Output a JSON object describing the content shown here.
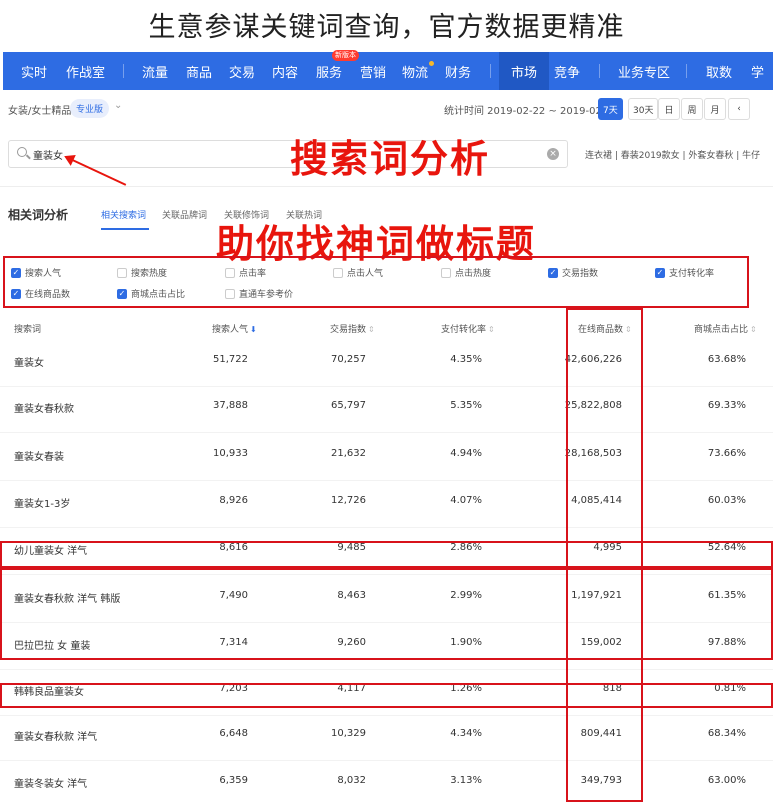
{
  "headline": "生意参谋关键词查询，官方数据更精准",
  "nav": {
    "items": [
      "实时",
      "作战室",
      "流量",
      "商品",
      "交易",
      "内容",
      "服务",
      "营销",
      "物流",
      "财务",
      "市场",
      "竞争",
      "业务专区",
      "取数",
      "学"
    ],
    "badge": "新版本",
    "active": "市场"
  },
  "filter": {
    "category": "女装/女士精品",
    "pro_badge": "专业版",
    "stat_time": "统计时间 2019-02-22 ~ 2019-02-28",
    "periods": [
      "7天",
      "30天",
      "日",
      "周",
      "月",
      "‹"
    ]
  },
  "search": {
    "value": "童装女",
    "hotwords": "连衣裙 | 春装2019款女 | 外套女春秋 | 牛仔"
  },
  "overlay": {
    "title1": "搜索词分析",
    "title2": "助你找神词做标题"
  },
  "section": {
    "title": "相关词分析",
    "tabs": [
      "相关搜索词",
      "关联品牌词",
      "关联修饰词",
      "关联热词"
    ]
  },
  "metrics": [
    {
      "label": "搜索人气",
      "checked": true
    },
    {
      "label": "搜索热度",
      "checked": false
    },
    {
      "label": "点击率",
      "checked": false
    },
    {
      "label": "点击人气",
      "checked": false
    },
    {
      "label": "点击热度",
      "checked": false
    },
    {
      "label": "交易指数",
      "checked": true
    },
    {
      "label": "支付转化率",
      "checked": true
    },
    {
      "label": "在线商品数",
      "checked": true
    },
    {
      "label": "商城点击占比",
      "checked": true
    },
    {
      "label": "直通车参考价",
      "checked": false
    }
  ],
  "table": {
    "headers": [
      "搜索词",
      "搜索人气",
      "交易指数",
      "支付转化率",
      "在线商品数",
      "商城点击占比"
    ],
    "rows": [
      [
        "童装女",
        "51,722",
        "70,257",
        "4.35%",
        "42,606,226",
        "63.68%"
      ],
      [
        "童装女春秋款",
        "37,888",
        "65,797",
        "5.35%",
        "25,822,808",
        "69.33%"
      ],
      [
        "童装女春装",
        "10,933",
        "21,632",
        "4.94%",
        "28,168,503",
        "73.66%"
      ],
      [
        "童装女1-3岁",
        "8,926",
        "12,726",
        "4.07%",
        "4,085,414",
        "60.03%"
      ],
      [
        "幼儿童装女 洋气",
        "8,616",
        "9,485",
        "2.86%",
        "4,995",
        "52.64%"
      ],
      [
        "童装女春秋款 洋气 韩版",
        "7,490",
        "8,463",
        "2.99%",
        "1,197,921",
        "61.35%"
      ],
      [
        "巴拉巴拉 女 童装",
        "7,314",
        "9,260",
        "1.90%",
        "159,002",
        "97.88%"
      ],
      [
        "韩韩良品童装女",
        "7,203",
        "4,117",
        "1.26%",
        "818",
        "0.81%"
      ],
      [
        "童装女春秋款 洋气",
        "6,648",
        "10,329",
        "4.34%",
        "809,441",
        "68.34%"
      ],
      [
        "童装冬装女 洋气",
        "6,359",
        "8,032",
        "3.13%",
        "349,793",
        "63.00%"
      ]
    ]
  },
  "colors": {
    "nav_bg": "#2e6ce3",
    "highlight_red": "#d8131b",
    "overlay_red": "#e8150d"
  }
}
